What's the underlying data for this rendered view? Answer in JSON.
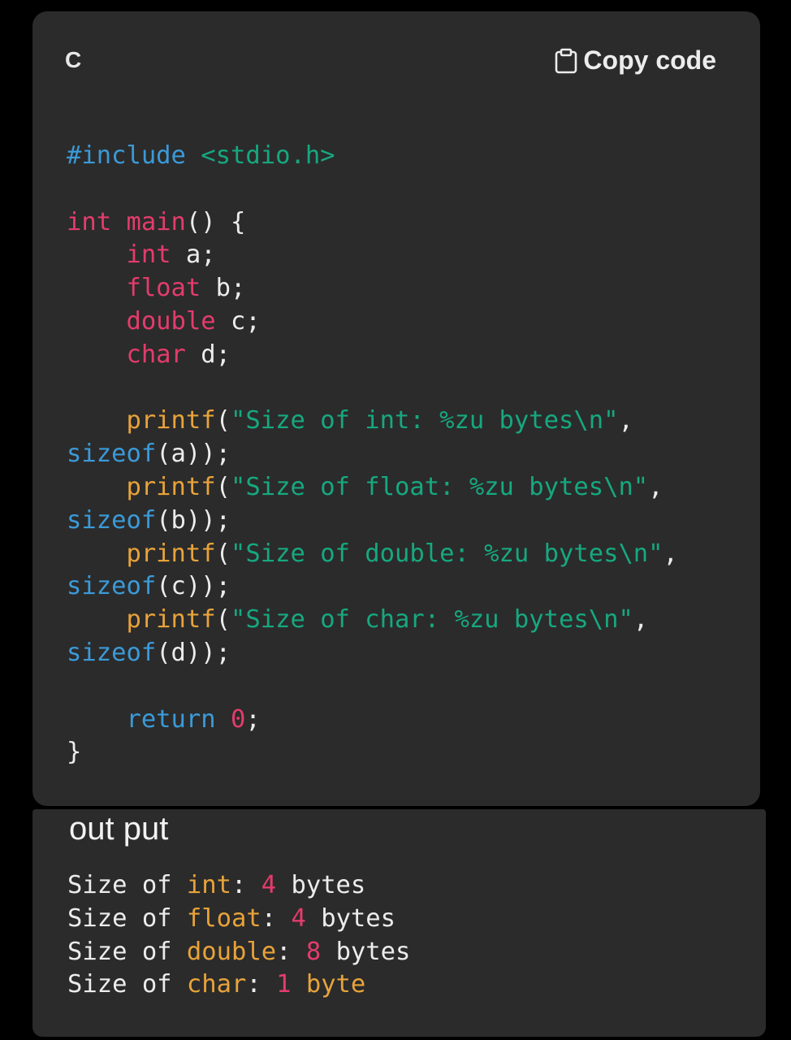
{
  "code_block": {
    "language_label": "C",
    "copy_button_label": "Copy code",
    "copy_icon": "clipboard-icon",
    "lines": [
      "",
      "#include <stdio.h>",
      "",
      "int main() {",
      "    int a;",
      "    float b;",
      "    double c;",
      "    char d;",
      "",
      "    printf(\"Size of int: %zu bytes\\n\",",
      "sizeof(a));",
      "    printf(\"Size of float: %zu bytes\\n\",",
      "sizeof(b));",
      "    printf(\"Size of double: %zu bytes\\n\",",
      "sizeof(c));",
      "    printf(\"Size of char: %zu bytes\\n\",",
      "sizeof(d));",
      "",
      "    return 0;",
      "}"
    ],
    "tokens": {
      "include_directive": "#include",
      "include_header": "<stdio.h>",
      "kw_int": "int",
      "fn_main": "main",
      "main_rest": "() {",
      "decl_a_type": "int",
      "decl_a_rest": " a;",
      "decl_b_type": "float",
      "decl_b_rest": " b;",
      "decl_c_type": "double",
      "decl_c_rest": " c;",
      "decl_d_type": "char",
      "decl_d_rest": " d;",
      "printf": "printf",
      "open_paren": "(",
      "str_int": "\"Size of int: %zu bytes\\n\"",
      "str_float": "\"Size of float: %zu bytes\\n\"",
      "str_double": "\"Size of double: %zu bytes\\n\"",
      "str_char": "\"Size of char: %zu bytes\\n\"",
      "comma": ",",
      "sizeof": "sizeof",
      "arg_a": "(a));",
      "arg_b": "(b));",
      "arg_c": "(c));",
      "arg_d": "(d));",
      "kw_return": "return",
      "ret_val": "0",
      "semicolon": ";",
      "close_brace": "}"
    },
    "colors": {
      "preprocessor": "#3b9ad8",
      "string": "#16a87f",
      "keyword_type": "#e33c6c",
      "function": "#e8a33a",
      "builtin": "#3b9ad8",
      "number": "#e33c6c",
      "plain": "#ececec",
      "background": "#2b2b2b"
    }
  },
  "output_block": {
    "title": "out put",
    "lines": [
      {
        "prefix": "Size of ",
        "type": "int",
        "colon": ": ",
        "value": "4",
        "unit": " bytes"
      },
      {
        "prefix": "Size of ",
        "type": "float",
        "colon": ": ",
        "value": "4",
        "unit": " bytes"
      },
      {
        "prefix": "Size of ",
        "type": "double",
        "colon": ": ",
        "value": "8",
        "unit": " bytes"
      },
      {
        "prefix": "Size of ",
        "type": "char",
        "colon": ": ",
        "value": "1",
        "unit": " byte"
      }
    ]
  }
}
